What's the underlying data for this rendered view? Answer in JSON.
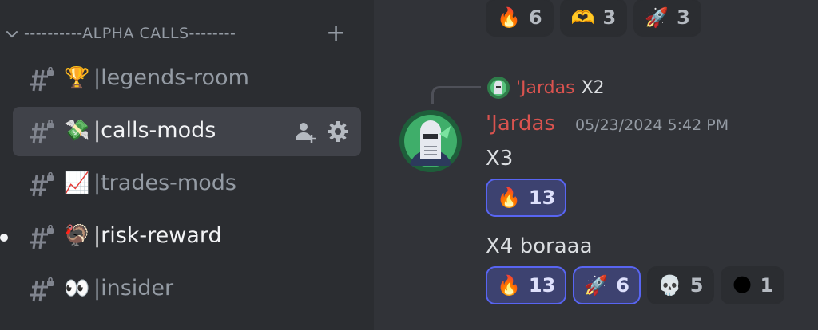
{
  "sidebar": {
    "category": {
      "label": "----------ALPHA CALLS--------",
      "plus": "+"
    },
    "channels": [
      {
        "emoji": "🏆",
        "name": "|legends-room",
        "state": "normal"
      },
      {
        "emoji": "💸",
        "name": "|calls-mods",
        "state": "selected"
      },
      {
        "emoji": "📈",
        "name": "|trades-mods",
        "state": "normal"
      },
      {
        "emoji": "🦃",
        "name": "|risk-reward",
        "state": "unread"
      },
      {
        "emoji": "👀",
        "name": "|insider",
        "state": "normal"
      }
    ]
  },
  "chat": {
    "top_reactions": [
      {
        "emoji": "🔥",
        "count": "6"
      },
      {
        "emoji": "🫶",
        "count": "3"
      },
      {
        "emoji": "🚀",
        "count": "3"
      }
    ],
    "reply": {
      "author": "'Jardas",
      "text": "X2"
    },
    "message": {
      "author": "'Jardas",
      "timestamp": "05/23/2024 5:42 PM",
      "lines": [
        "X3",
        "X4 boraaa"
      ],
      "reactions_line1": [
        {
          "emoji": "🔥",
          "count": "13"
        }
      ],
      "reactions_line2": [
        {
          "emoji": "🔥",
          "count": "13"
        },
        {
          "emoji": "🚀",
          "count": "6"
        },
        {
          "emoji": "💀",
          "count": "5"
        },
        {
          "emoji": "🌑",
          "count": "1"
        }
      ]
    }
  },
  "colors": {
    "sidebar_bg": "#2b2d31",
    "chat_bg": "#313338",
    "selected_bg": "#404249",
    "author": "#d9534f",
    "reaction_me_border": "#5865f2"
  }
}
